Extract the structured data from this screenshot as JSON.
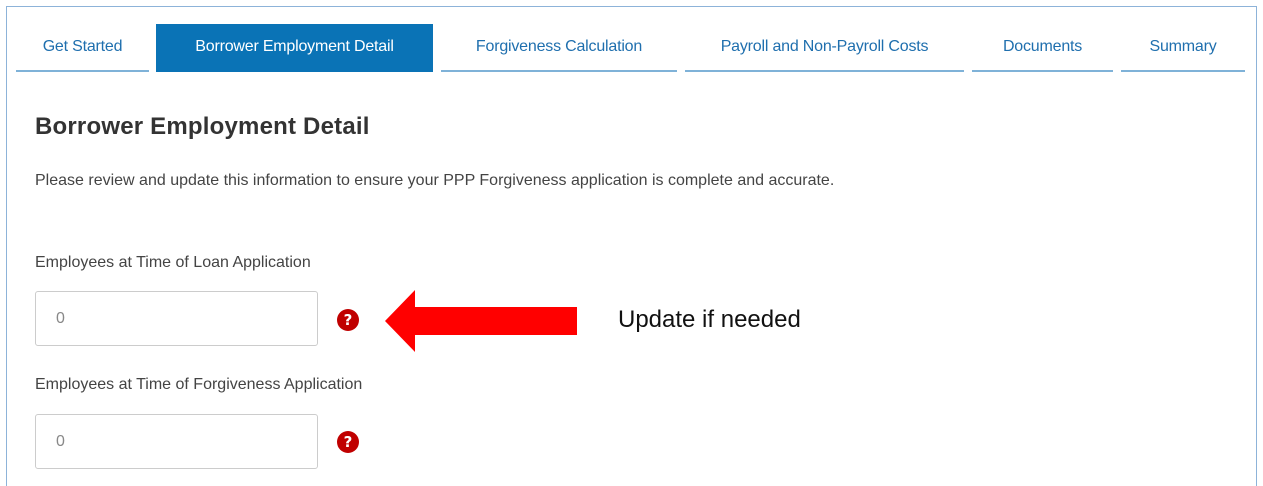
{
  "tabs": [
    {
      "label": "Get Started",
      "active": false
    },
    {
      "label": "Borrower Employment Detail",
      "active": true
    },
    {
      "label": "Forgiveness Calculation",
      "active": false
    },
    {
      "label": "Payroll and Non-Payroll Costs",
      "active": false
    },
    {
      "label": "Documents",
      "active": false
    },
    {
      "label": "Summary",
      "active": false
    }
  ],
  "page": {
    "title": "Borrower Employment Detail",
    "description": "Please review and update this information to ensure your PPP Forgiveness application is complete and accurate."
  },
  "fields": [
    {
      "label": "Employees at Time of Loan Application",
      "value": "0",
      "help_icon": "question-circle-icon"
    },
    {
      "label": "Employees at Time of Forgiveness Application",
      "value": "0",
      "help_icon": "question-circle-icon"
    }
  ],
  "annotation": {
    "text": "Update if needed",
    "arrow_color": "#ff0000",
    "arrow_icon": "left-arrow-icon"
  },
  "colors": {
    "accent": "#0a73b6",
    "tab_text": "#1f6fae",
    "help_icon": "#c00000"
  }
}
